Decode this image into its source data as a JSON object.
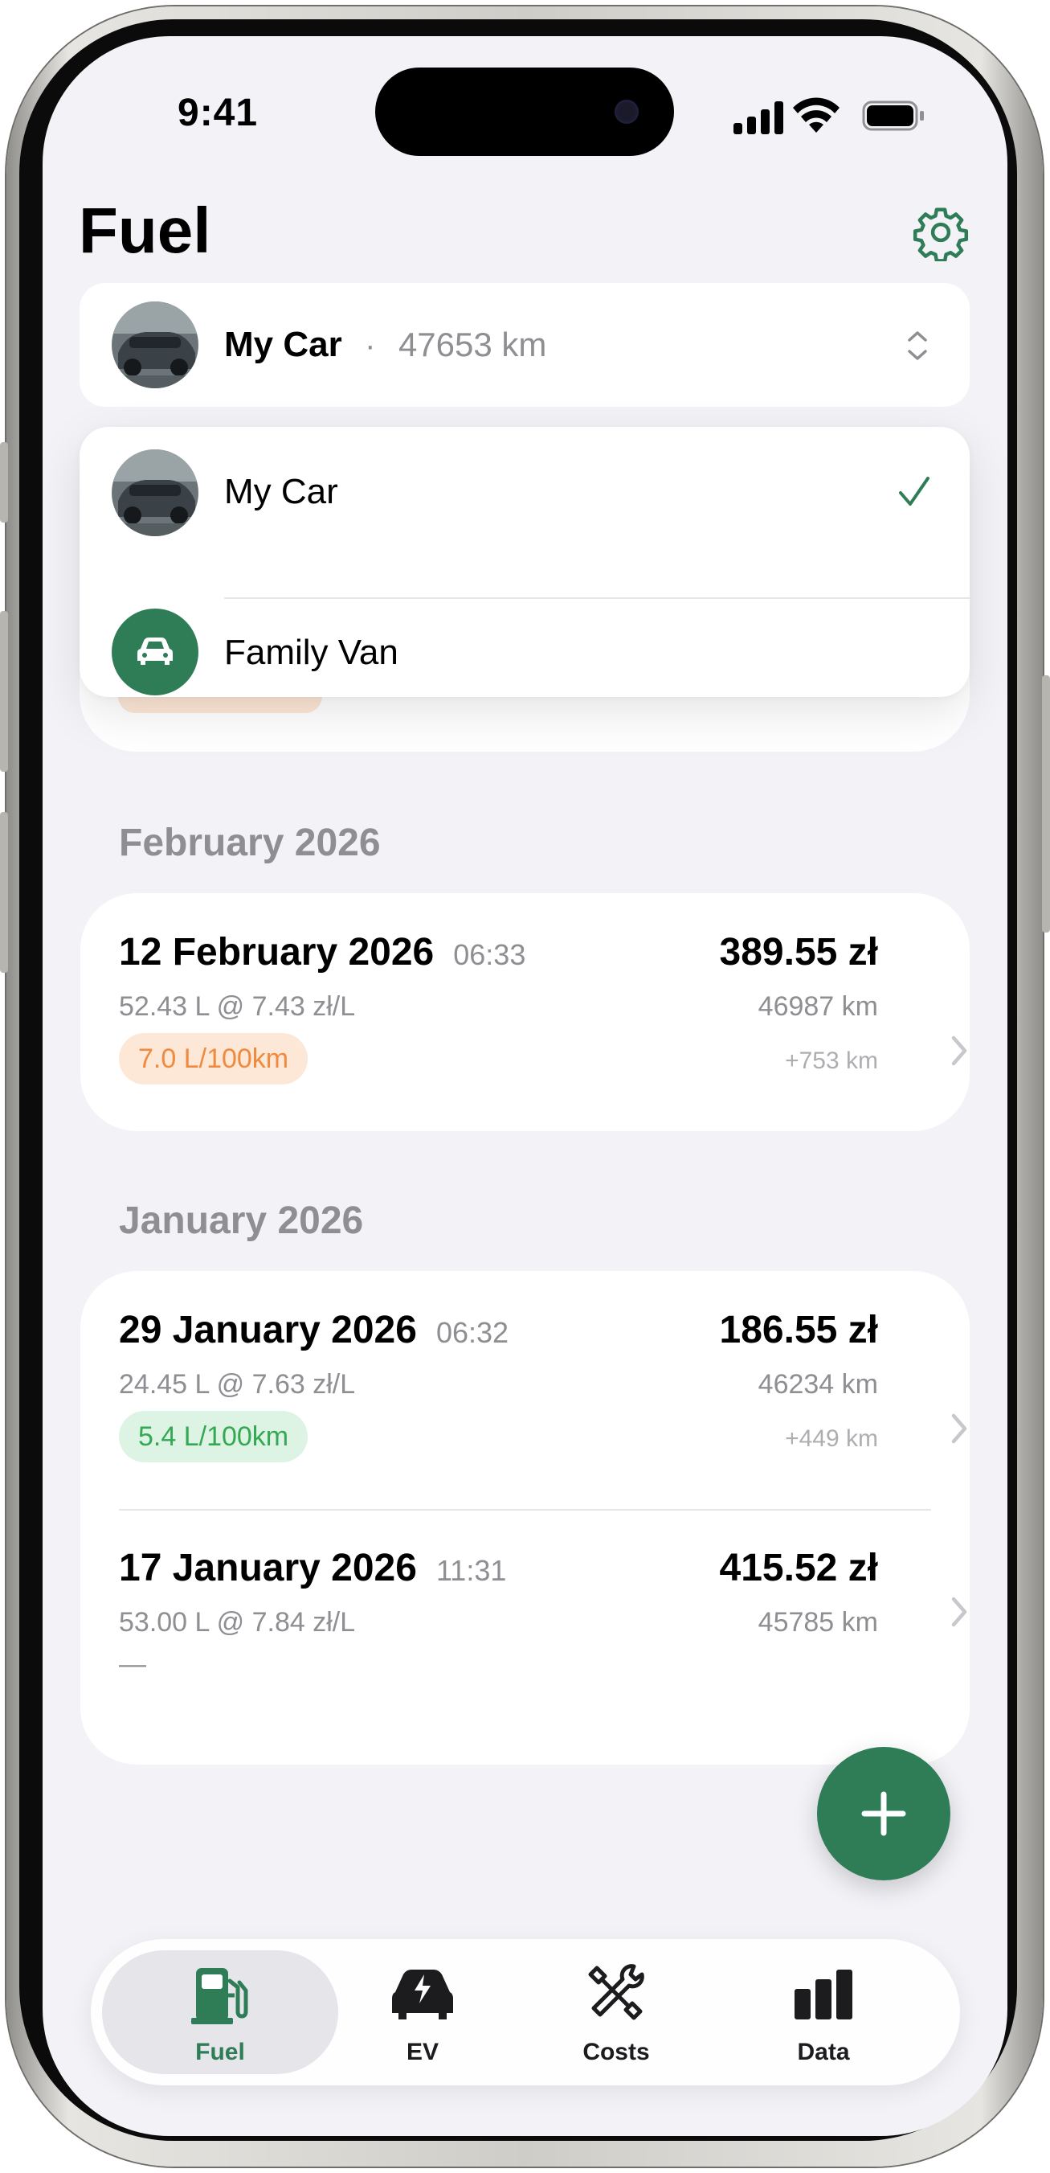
{
  "status_bar": {
    "time": "9:41"
  },
  "header": {
    "title": "Fuel"
  },
  "vehicle_selector": {
    "name": "My Car",
    "separator": "·",
    "odometer": "47653 km"
  },
  "vehicle_menu": {
    "items": [
      {
        "label": "My Car",
        "selected": true
      },
      {
        "label": "Family Van",
        "selected": false
      }
    ]
  },
  "sections": [
    {
      "header": "February 2026",
      "entries": [
        {
          "date": "12 February 2026",
          "time": "06:33",
          "detail": "52.43 L @ 7.43 zł/L",
          "price": "389.55 zł",
          "odometer": "46987 km",
          "delta": "+753 km",
          "consumption": "7.0 L/100km",
          "consumption_level": "orange"
        }
      ]
    },
    {
      "header": "January 2026",
      "entries": [
        {
          "date": "29 January 2026",
          "time": "06:32",
          "detail": "24.45 L @ 7.63 zł/L",
          "price": "186.55 zł",
          "odometer": "46234 km",
          "delta": "+449 km",
          "consumption": "5.4 L/100km",
          "consumption_level": "green"
        },
        {
          "date": "17 January 2026",
          "time": "11:31",
          "detail": "53.00 L @ 7.84 zł/L",
          "price": "415.52 zł",
          "odometer": "45785 km",
          "delta": "",
          "consumption": "—",
          "consumption_level": "none"
        }
      ]
    }
  ],
  "tabs": [
    {
      "label": "Fuel",
      "icon": "fuel-pump-icon",
      "active": true
    },
    {
      "label": "EV",
      "icon": "ev-car-icon",
      "active": false
    },
    {
      "label": "Costs",
      "icon": "tools-icon",
      "active": false
    },
    {
      "label": "Data",
      "icon": "bar-chart-icon",
      "active": false
    }
  ],
  "colors": {
    "accent": "#2e7d57",
    "background": "#f2f2f7",
    "orange_pill_bg": "#fde7d6",
    "orange_pill_text": "#f08a3e",
    "green_pill_bg": "#ddf4e4",
    "green_pill_text": "#34a853"
  }
}
